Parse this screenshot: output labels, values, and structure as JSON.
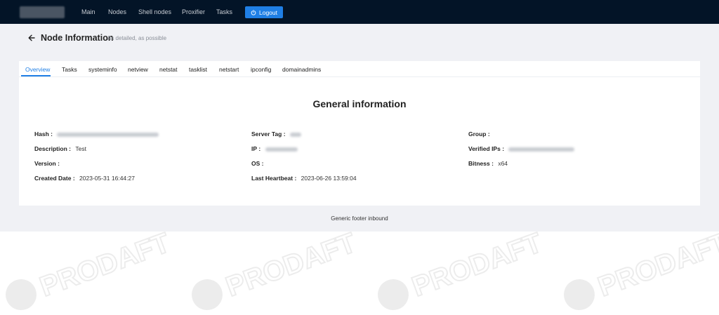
{
  "nav": {
    "items": [
      "Main",
      "Nodes",
      "Shell nodes",
      "Proxifier",
      "Tasks"
    ],
    "logout_label": "Logout"
  },
  "page": {
    "title": "Node Information",
    "subtitle": "As detailed, as possible"
  },
  "tabs": [
    "Overview",
    "Tasks",
    "systeminfo",
    "netview",
    "netstat",
    "tasklist",
    "netstart",
    "ipconfig",
    "domainadmins"
  ],
  "active_tab": "Overview",
  "general": {
    "title": "General information",
    "hash_label": "Hash",
    "description_label": "Description",
    "description_value": "Test",
    "version_label": "Version",
    "created_label": "Created Date",
    "created_value": "2023-05-31 16:44:27",
    "server_tag_label": "Server Tag",
    "ip_label": "IP",
    "os_label": "OS",
    "heartbeat_label": "Last Heartbeat",
    "heartbeat_value": "2023-06-26 13:59:04",
    "group_label": "Group",
    "verified_ips_label": "Verified IPs",
    "bitness_label": "Bitness",
    "bitness_value": "x64",
    "separator": ":"
  },
  "footer": "Generic footer inbound",
  "watermark_text": "PRODAFT",
  "colors": {
    "topbar": "#031427",
    "accent": "#1f7fe5",
    "content_bg": "#f0f1f5"
  }
}
